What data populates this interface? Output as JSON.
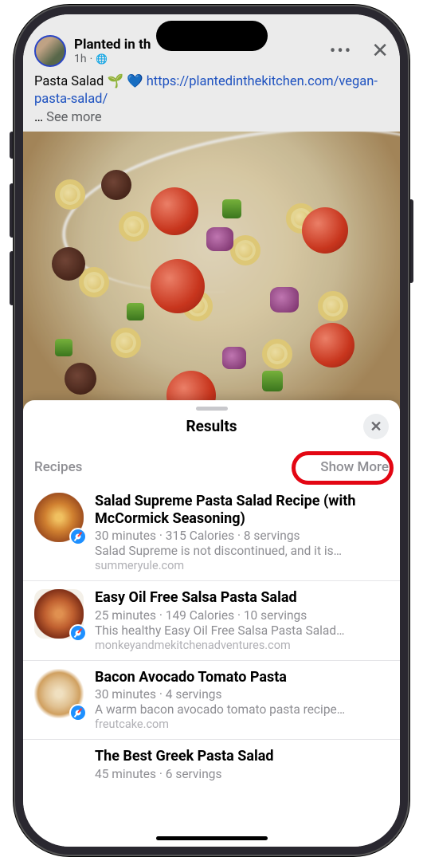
{
  "post": {
    "author": "Planted in th",
    "time": "1h",
    "privacy_icon": "🌐",
    "body_text": "Pasta Salad",
    "emoji_leaf": "🌱",
    "emoji_heart": "💙",
    "link": "https://plantedinthekitchen.com/vegan-pasta-salad/",
    "ellipsis": "…",
    "see_more": "See more"
  },
  "sheet": {
    "title": "Results",
    "section_label": "Recipes",
    "show_more": "Show More"
  },
  "results": [
    {
      "title": "Salad Supreme Pasta Salad Recipe (with McCormick Seasoning)",
      "meta": "30 minutes · 315 Calories · 8 servings",
      "desc": "Salad Supreme is not discontinued, and it is…",
      "domain": "summeryule.com"
    },
    {
      "title": "Easy Oil Free Salsa Pasta Salad",
      "meta": "25 minutes · 149 Calories · 10 servings",
      "desc": "This healthy Easy Oil Free Salsa Pasta Salad…",
      "domain": "monkeyandmekitchenadventures.com"
    },
    {
      "title": "Bacon Avocado Tomato Pasta",
      "meta": "30 minutes · 4 servings",
      "desc": "A warm bacon avocado tomato pasta recipe…",
      "domain": "freutcake.com"
    },
    {
      "title": "The Best Greek Pasta Salad",
      "meta": "45 minutes · 6 servings",
      "desc": "",
      "domain": ""
    }
  ]
}
